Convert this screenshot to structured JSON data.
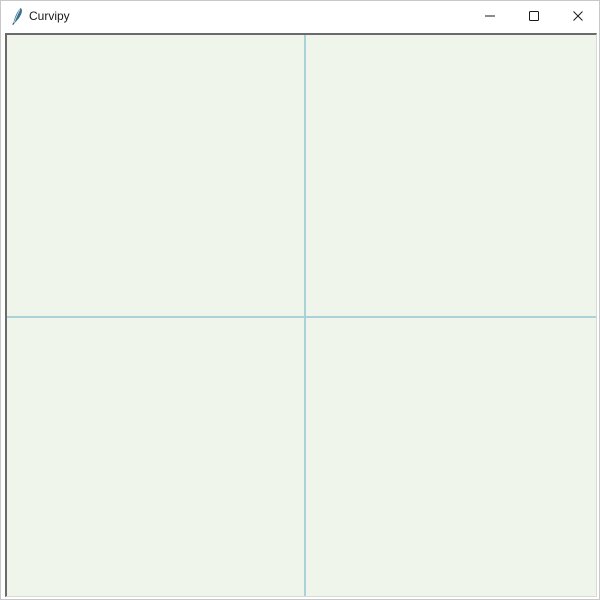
{
  "window": {
    "title": "Curvipy",
    "app_icon": "feather-icon",
    "controls": {
      "minimize_icon": "minimize-icon",
      "maximize_icon": "maximize-icon",
      "close_icon": "close-icon"
    }
  },
  "canvas": {
    "background_color": "#eff5eb",
    "axis_color": "#a9d3d9"
  }
}
